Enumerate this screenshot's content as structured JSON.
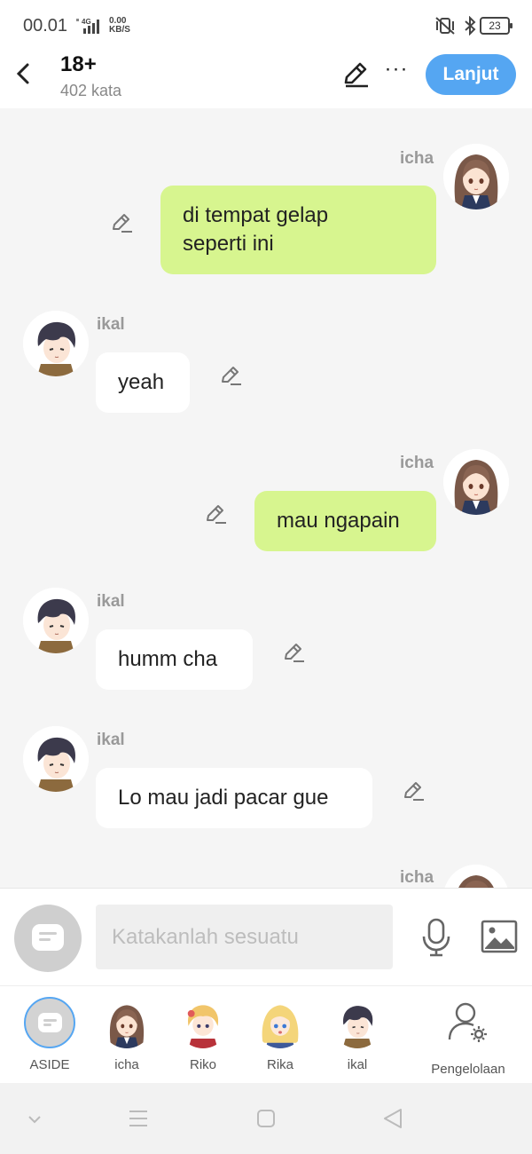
{
  "status": {
    "time": "00.01",
    "network": "4G",
    "speed_value": "0.00",
    "speed_unit": "KB/S",
    "battery": "23"
  },
  "header": {
    "title": "18+",
    "word_count": "402 kata",
    "next_label": "Lanjut"
  },
  "chat": {
    "messages": [
      {
        "sender": "icha",
        "text_line1": "di tempat gelap",
        "text_line2": "seperti ini"
      },
      {
        "sender": "ikal",
        "text": "yeah"
      },
      {
        "sender": "icha",
        "text": "mau ngapain"
      },
      {
        "sender": "ikal",
        "text": "humm cha"
      },
      {
        "sender": "ikal",
        "text": "Lo mau jadi pacar gue"
      },
      {
        "sender": "icha"
      }
    ]
  },
  "input": {
    "placeholder": "Katakanlah sesuatu"
  },
  "characters": [
    {
      "label": "ASIDE"
    },
    {
      "label": "icha"
    },
    {
      "label": "Riko"
    },
    {
      "label": "Rika"
    },
    {
      "label": "ikal"
    },
    {
      "label": "Pengelolaan"
    }
  ],
  "colors": {
    "accent": "#55a6f2",
    "my_bubble": "#d7f58f",
    "other_bubble": "#ffffff",
    "background": "#f5f5f5"
  },
  "icons": {
    "back": "chevron-left-icon",
    "edit": "pencil-icon",
    "more": "more-icon",
    "mic": "microphone-icon",
    "image": "image-icon",
    "manage": "user-settings-icon"
  }
}
